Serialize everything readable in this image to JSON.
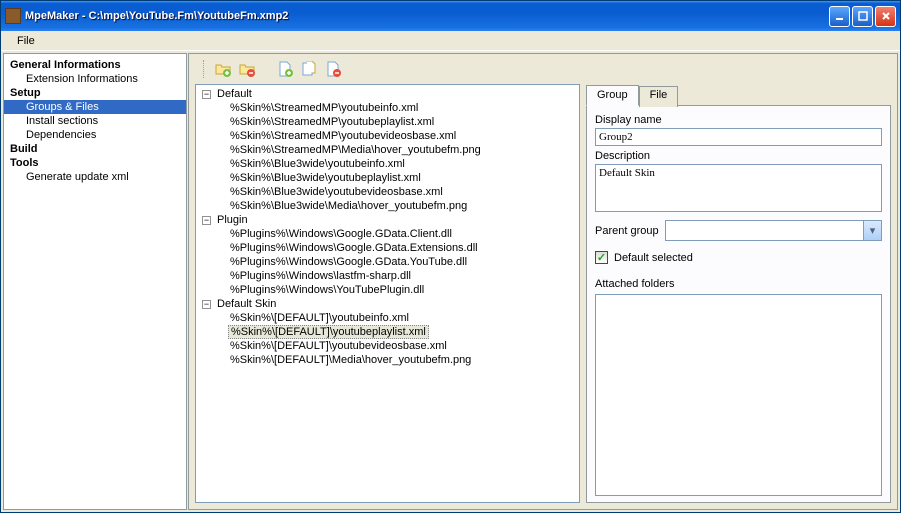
{
  "window": {
    "title": "MpeMaker - C:\\mpe\\YouTube.Fm\\YoutubeFm.xmp2"
  },
  "menu": {
    "file": "File"
  },
  "sidebar": {
    "s1": "General Informations",
    "s1a": "Extension Informations",
    "s2": "Setup",
    "s2a": "Groups & Files",
    "s2b": "Install sections",
    "s2c": "Dependencies",
    "s3": "Build",
    "s4": "Tools",
    "s4a": "Generate update xml"
  },
  "tree": {
    "n0": "Default",
    "n0_0": "%Skin%\\StreamedMP\\youtubeinfo.xml",
    "n0_1": "%Skin%\\StreamedMP\\youtubeplaylist.xml",
    "n0_2": "%Skin%\\StreamedMP\\youtubevideosbase.xml",
    "n0_3": "%Skin%\\StreamedMP\\Media\\hover_youtubefm.png",
    "n0_4": "%Skin%\\Blue3wide\\youtubeinfo.xml",
    "n0_5": "%Skin%\\Blue3wide\\youtubeplaylist.xml",
    "n0_6": "%Skin%\\Blue3wide\\youtubevideosbase.xml",
    "n0_7": "%Skin%\\Blue3wide\\Media\\hover_youtubefm.png",
    "n1": "Plugin",
    "n1_0": "%Plugins%\\Windows\\Google.GData.Client.dll",
    "n1_1": "%Plugins%\\Windows\\Google.GData.Extensions.dll",
    "n1_2": "%Plugins%\\Windows\\Google.GData.YouTube.dll",
    "n1_3": "%Plugins%\\Windows\\lastfm-sharp.dll",
    "n1_4": "%Plugins%\\Windows\\YouTubePlugin.dll",
    "n2": "Default Skin",
    "n2_0": "%Skin%\\[DEFAULT]\\youtubeinfo.xml",
    "n2_1": "%Skin%\\[DEFAULT]\\youtubeplaylist.xml",
    "n2_2": "%Skin%\\[DEFAULT]\\youtubevideosbase.xml",
    "n2_3": "%Skin%\\[DEFAULT]\\Media\\hover_youtubefm.png"
  },
  "right": {
    "tab_group": "Group",
    "tab_file": "File",
    "lbl_display": "Display name",
    "val_display": "Group2",
    "lbl_desc": "Description",
    "val_desc": "Default Skin",
    "lbl_parent": "Parent group",
    "lbl_default": "Default selected",
    "lbl_attached": "Attached folders"
  }
}
